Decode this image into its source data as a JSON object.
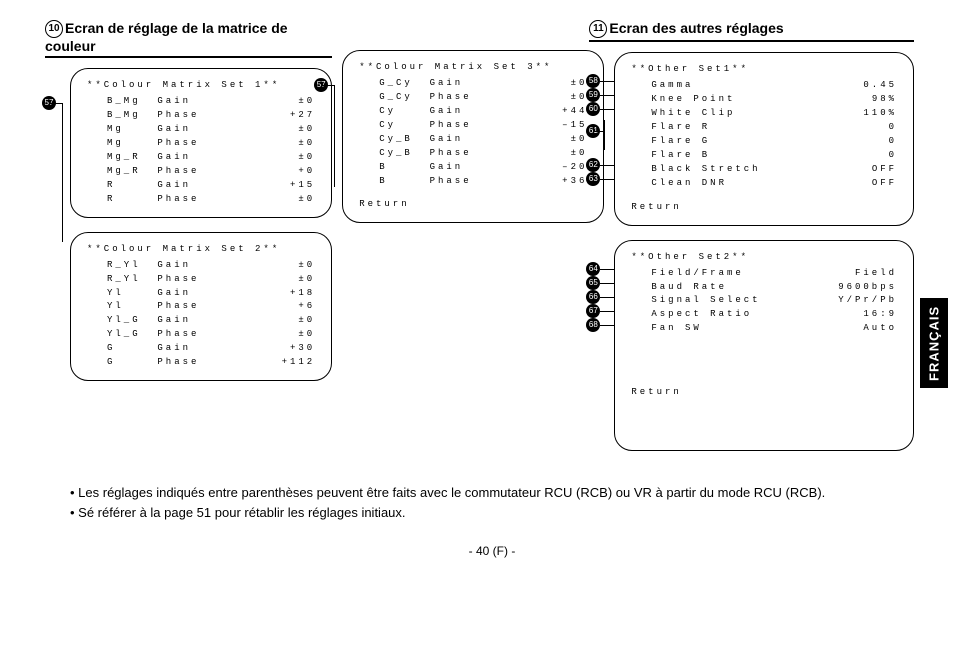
{
  "section10": {
    "number": "10",
    "title": "Ecran de réglage de la matrice de couleur"
  },
  "section11": {
    "number": "11",
    "title": "Ecran des autres réglages"
  },
  "return_label": "Return",
  "box1": {
    "title": "**Colour Matrix Set 1**",
    "rows": [
      {
        "label": "B_Mg  Gain",
        "value": "±0"
      },
      {
        "label": "B_Mg  Phase",
        "value": "+27"
      },
      {
        "label": "Mg    Gain",
        "value": "±0"
      },
      {
        "label": "Mg    Phase",
        "value": "±0"
      },
      {
        "label": "Mg_R  Gain",
        "value": "±0"
      },
      {
        "label": "Mg_R  Phase",
        "value": "+0"
      },
      {
        "label": "R     Gain",
        "value": "+15"
      },
      {
        "label": "R     Phase",
        "value": "±0"
      }
    ]
  },
  "box2": {
    "title": "**Colour Matrix Set 2**",
    "rows": [
      {
        "label": "R_Yl  Gain",
        "value": "±0"
      },
      {
        "label": "R_Yl  Phase",
        "value": "±0"
      },
      {
        "label": "Yl    Gain",
        "value": "+18"
      },
      {
        "label": "Yl    Phase",
        "value": "+6"
      },
      {
        "label": "Yl_G  Gain",
        "value": "±0"
      },
      {
        "label": "Yl_G  Phase",
        "value": "±0"
      },
      {
        "label": "G     Gain",
        "value": "+30"
      },
      {
        "label": "G     Phase",
        "value": "+112"
      }
    ]
  },
  "box3": {
    "title": "**Colour Matrix Set 3**",
    "rows": [
      {
        "label": "G_Cy  Gain",
        "value": "±0"
      },
      {
        "label": "G_Cy  Phase",
        "value": "±0"
      },
      {
        "label": "Cy    Gain",
        "value": "+44"
      },
      {
        "label": "Cy    Phase",
        "value": "–15"
      },
      {
        "label": "Cy_B  Gain",
        "value": "±0"
      },
      {
        "label": "Cy_B  Phase",
        "value": "±0"
      },
      {
        "label": "B     Gain",
        "value": "–20"
      },
      {
        "label": "B     Phase",
        "value": "+36"
      }
    ]
  },
  "box4": {
    "title": "**Other Set1**",
    "rows": [
      {
        "label": "Gamma",
        "value": "0.45"
      },
      {
        "label": "Knee Point",
        "value": "98%"
      },
      {
        "label": "White Clip",
        "value": "110%"
      },
      {
        "label": "Flare R",
        "value": "0"
      },
      {
        "label": "Flare G",
        "value": "0"
      },
      {
        "label": "Flare B",
        "value": "0"
      },
      {
        "label": "Black Stretch",
        "value": "OFF"
      },
      {
        "label": "Clean DNR",
        "value": "OFF"
      }
    ]
  },
  "box5": {
    "title": "**Other Set2**",
    "rows": [
      {
        "label": "Field/Frame",
        "value": "Field"
      },
      {
        "label": "Baud Rate",
        "value": "9600bps"
      },
      {
        "label": "Signal Select",
        "value": "Y/Pr/Pb"
      },
      {
        "label": "Aspect Ratio",
        "value": "16:9"
      },
      {
        "label": "Fan SW",
        "value": "Auto"
      }
    ]
  },
  "callouts": {
    "c57a": "57",
    "c57b": "57",
    "c58": "58",
    "c59": "59",
    "c60": "60",
    "c61": "61",
    "c62": "62",
    "c63": "63",
    "c64": "64",
    "c65": "65",
    "c66": "66",
    "c67": "67",
    "c68": "68"
  },
  "footnotes": {
    "f1": "• Les réglages indiqués entre parenthèses peuvent être faits avec le commutateur RCU (RCB) ou VR à partir du mode RCU (RCB).",
    "f2": "• Sé référer à la page 51 pour rétablir les réglages initiaux."
  },
  "pagefoot": "- 40 (F) -",
  "language_tab": "FRANÇAIS"
}
